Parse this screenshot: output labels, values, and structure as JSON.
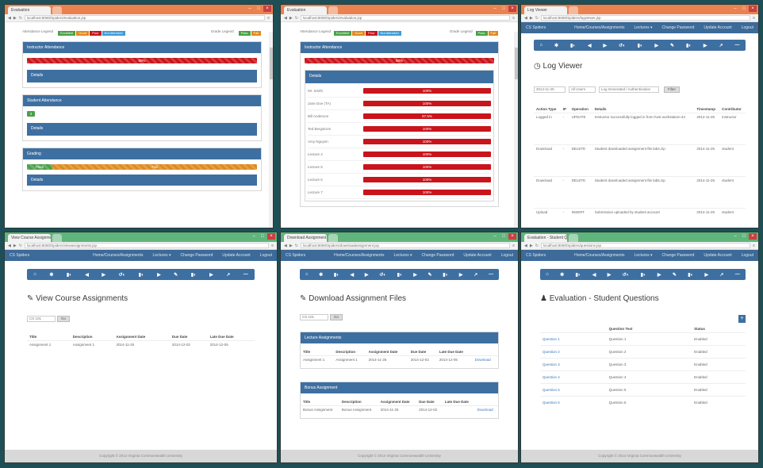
{
  "common": {
    "app_name": "CS Spiders",
    "nav_links": [
      "Home/Courses/Assignments",
      "Lectures ▾",
      "Change Password",
      "Update Account",
      "Logout"
    ],
    "toolbar_icons": [
      "home-icon",
      "refresh-icon",
      "chart-icon",
      "back-icon",
      "forward-icon",
      "stats-icon",
      "download-icon",
      "upload-icon",
      "edit-icon",
      "graph-icon",
      "list-icon",
      "share-icon",
      "minus-icon"
    ],
    "toolbar_glyphs": [
      "⌂",
      "✱",
      "▮◐",
      "◀",
      "▶",
      "↺◐",
      "▮◐",
      "▶",
      "✎",
      "▮◐",
      "▶",
      "↗",
      "—"
    ],
    "footer": "Copyright © 2014 Virginia Commonwealth University"
  },
  "w1": {
    "tab": "Evaluation",
    "url": "localhost:8080/Spiders/evaluation.jsp",
    "legend_label": "Attendance Legend",
    "legend": [
      {
        "label": "Excellent",
        "color": "#4aa047"
      },
      {
        "label": "Good",
        "color": "#e08a1d"
      },
      {
        "label": "Poor",
        "color": "#c9141b"
      },
      {
        "label": "Not Attended",
        "color": "#3d9bd6"
      }
    ],
    "grade_label": "Grade Legend",
    "grade_legend": [
      {
        "label": "Pass",
        "color": "#4aa047"
      },
      {
        "label": "Fail",
        "color": "#e08a1d"
      }
    ],
    "sections": [
      {
        "title": "Instructor Attendance",
        "bar": "80%",
        "details": "Details"
      },
      {
        "title": "Student Attendance",
        "badge": "3",
        "details": "Details"
      },
      {
        "title": "Grading",
        "bar_green": "Pass",
        "bar_orange": "Fail",
        "details": "Details"
      }
    ]
  },
  "w2": {
    "tab": "Evaluation",
    "url": "localhost:8080/Spiders/evaluation.jsp",
    "legend_label": "Attendance Legend",
    "grade_label": "Grade Legend",
    "panel_title": "Instructor Attendance",
    "top_bar": "80%",
    "details": "Details",
    "rows": [
      {
        "name": "Mr. Smith",
        "value": "100%"
      },
      {
        "name": "Jane Doe (TA)",
        "value": "100%"
      },
      {
        "name": "Bill Anderson",
        "value": "87.5%"
      },
      {
        "name": "Ted Bergstrom",
        "value": "100%"
      },
      {
        "name": "Amy Nguyen",
        "value": "100%"
      },
      {
        "name": "Lecture 4",
        "value": "100%"
      },
      {
        "name": "Lecture 5",
        "value": "100%"
      },
      {
        "name": "Lecture 6",
        "value": "100%"
      },
      {
        "name": "Lecture 7",
        "value": "100%"
      }
    ]
  },
  "w3": {
    "tab": "Log Viewer",
    "url": "localhost:8080/Spiders/logviewer.jsp",
    "heading": "Log Viewer",
    "filter_date": "2014-11-25",
    "filter_user": "All Users",
    "filter_type": "Log Generated / Authentication",
    "filter_btn": "Filter",
    "columns": [
      "Action Type",
      "IP",
      "Operation",
      "Details",
      "Timestamp",
      "Contributor"
    ],
    "rows": [
      {
        "type": "Logged in",
        "ip": "-",
        "op": "UPDATE",
        "details": "Instructor successfully logged in from host workstation-44",
        "time": "2014-11-25",
        "user": "instructor"
      },
      {
        "type": "Download",
        "ip": "-",
        "op": "DELETE",
        "details": "Student downloaded assignment file lab4.zip",
        "time": "2014-11-25",
        "user": "student"
      },
      {
        "type": "Download",
        "ip": "-",
        "op": "DELETE",
        "details": "Student downloaded assignment file lab5.zip",
        "time": "2014-11-25",
        "user": "student"
      },
      {
        "type": "Upload",
        "ip": "-",
        "op": "INSERT",
        "details": "Submission uploaded by student account",
        "time": "2014-11-25",
        "user": "student"
      }
    ]
  },
  "w4": {
    "tab": "View Course Assignments",
    "url": "localhost:8080/Spiders/viewassignments.jsp",
    "heading": "View Course Assignments",
    "select": "CS 101",
    "btn": "Go",
    "columns": [
      "Title",
      "Description",
      "Assignment Date",
      "Due Date",
      "Late Due Date"
    ],
    "rows": [
      {
        "title": "Assignment 1",
        "desc": "Assignment 1",
        "a": "2014-11-25",
        "b": "2014-12-02",
        "c": "2014-12-05"
      }
    ]
  },
  "w5": {
    "tab": "Download Assignment Files",
    "url": "localhost:8080/Spiders/downloadassignment.jsp",
    "heading": "Download Assignment Files",
    "select": "CS 101",
    "btn": "Go",
    "panels": [
      {
        "title": "Lecture Assignments",
        "columns": [
          "Title",
          "Description",
          "Assignment Date",
          "Due Date",
          "Late Due Date"
        ],
        "rows": [
          {
            "title": "Assignment 1",
            "desc": "Assignment 1",
            "a": "2014-11-25",
            "b": "2014-12-02",
            "c": "2014-12-05",
            "action": "Download"
          }
        ]
      },
      {
        "title": "Bonus Assignment",
        "columns": [
          "Title",
          "Description",
          "Assignment Date",
          "Due Date",
          "Late Due Date"
        ],
        "rows": [
          {
            "title": "Bonus Assignment",
            "desc": "Bonus Assignment",
            "a": "2014-11-25",
            "b": "2014-12-02",
            "c": "",
            "action": "Download"
          }
        ]
      }
    ]
  },
  "w6": {
    "tab": "Evaluation - Student Questions",
    "url": "localhost:8080/Spiders/questions.jsp",
    "heading": "Evaluation - Student Questions",
    "add_btn": "+",
    "columns": [
      "",
      "Question Text",
      "Status"
    ],
    "rows": [
      {
        "link": "Question 1",
        "text": "Question 1",
        "status": "Enabled"
      },
      {
        "link": "Question 2",
        "text": "Question 2",
        "status": "Enabled"
      },
      {
        "link": "Question 3",
        "text": "Question 3",
        "status": "Enabled"
      },
      {
        "link": "Question 4",
        "text": "Question 4",
        "status": "Enabled"
      },
      {
        "link": "Question 5",
        "text": "Question 5",
        "status": "Enabled"
      },
      {
        "link": "Question 6",
        "text": "Question 6",
        "status": "Enabled"
      }
    ]
  }
}
